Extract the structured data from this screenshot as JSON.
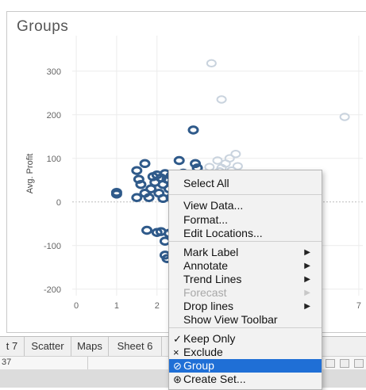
{
  "viz": {
    "title": "Groups"
  },
  "chart_data": {
    "type": "scatter",
    "ylabel": "Avg. Profit",
    "xlabel": "",
    "ylim": [
      -215,
      345
    ],
    "xlim": [
      -0.1,
      7.1
    ],
    "y_ticks": [
      "300",
      "200",
      "100",
      "0",
      "-100",
      "-200"
    ],
    "x_ticks": [
      "0",
      "1",
      "2",
      "7"
    ],
    "grid": true,
    "colors": {
      "selected": "#2f5a8a",
      "selected_fill": "#4f7fb4",
      "unselected": "#c9d3de"
    },
    "series": [
      {
        "name": "",
        "values": [
          [
            1.0,
            22
          ],
          [
            1.0,
            18
          ],
          [
            1.5,
            72
          ],
          [
            1.55,
            52
          ],
          [
            1.5,
            10
          ],
          [
            1.7,
            88
          ],
          [
            1.6,
            40
          ],
          [
            1.85,
            30
          ],
          [
            1.9,
            58
          ],
          [
            1.95,
            45
          ],
          [
            2.0,
            62
          ],
          [
            2.05,
            20
          ],
          [
            2.1,
            55
          ],
          [
            2.15,
            40
          ],
          [
            2.2,
            65
          ],
          [
            2.25,
            52
          ],
          [
            2.3,
            30
          ],
          [
            2.35,
            60
          ],
          [
            2.4,
            48
          ],
          [
            2.45,
            18
          ],
          [
            2.5,
            58
          ],
          [
            2.55,
            95
          ],
          [
            2.6,
            42
          ],
          [
            2.65,
            66
          ],
          [
            2.7,
            25
          ],
          [
            2.75,
            55
          ],
          [
            2.8,
            35
          ],
          [
            2.85,
            62
          ],
          [
            2.9,
            165
          ],
          [
            2.95,
            88
          ],
          [
            3.0,
            78
          ],
          [
            3.0,
            58
          ],
          [
            1.7,
            20
          ],
          [
            1.8,
            10
          ],
          [
            2.15,
            8
          ],
          [
            2.35,
            10
          ],
          [
            2.45,
            22
          ],
          [
            2.6,
            12
          ],
          [
            1.75,
            -65
          ],
          [
            2.0,
            -70
          ],
          [
            2.1,
            -68
          ],
          [
            2.2,
            -90
          ],
          [
            2.3,
            -72
          ],
          [
            2.4,
            -66
          ],
          [
            2.2,
            -122
          ],
          [
            2.25,
            -130
          ],
          [
            2.5,
            -125
          ]
        ]
      },
      {
        "name": "",
        "values": [
          [
            3.35,
            318
          ],
          [
            3.6,
            235
          ],
          [
            6.65,
            195
          ],
          [
            3.2,
            65
          ],
          [
            3.3,
            80
          ],
          [
            3.4,
            50
          ],
          [
            3.5,
            95
          ],
          [
            3.55,
            70
          ],
          [
            3.6,
            78
          ],
          [
            3.65,
            60
          ],
          [
            3.7,
            88
          ],
          [
            3.75,
            55
          ],
          [
            3.8,
            100
          ],
          [
            3.85,
            72
          ],
          [
            3.9,
            45
          ],
          [
            3.95,
            110
          ],
          [
            4.0,
            82
          ],
          [
            4.05,
            65
          ],
          [
            4.1,
            48
          ],
          [
            3.45,
            35
          ],
          [
            3.7,
            40
          ],
          [
            3.9,
            30
          ],
          [
            4.35,
            48
          ],
          [
            4.5,
            46
          ],
          [
            4.9,
            44
          ],
          [
            5.0,
            42
          ],
          [
            4.2,
            40
          ]
        ]
      }
    ]
  },
  "tabs": [
    "t 7",
    "Scatter",
    "Maps",
    "Sheet 6"
  ],
  "status": {
    "left_text": "37"
  },
  "context_menu": {
    "items": [
      {
        "label": "Select All",
        "arrow": false,
        "disabled": false,
        "check": "",
        "selected": false
      },
      {
        "label": "View Data...",
        "arrow": false,
        "disabled": false,
        "check": "",
        "selected": false
      },
      {
        "label": "Format...",
        "arrow": false,
        "disabled": false,
        "check": "",
        "selected": false
      },
      {
        "label": "Edit Locations...",
        "arrow": false,
        "disabled": false,
        "check": "",
        "selected": false
      },
      {
        "label": "Mark Label",
        "arrow": true,
        "disabled": false,
        "check": "",
        "selected": false
      },
      {
        "label": "Annotate",
        "arrow": true,
        "disabled": false,
        "check": "",
        "selected": false
      },
      {
        "label": "Trend Lines",
        "arrow": true,
        "disabled": false,
        "check": "",
        "selected": false
      },
      {
        "label": "Forecast",
        "arrow": true,
        "disabled": true,
        "check": "",
        "selected": false
      },
      {
        "label": "Drop lines",
        "arrow": true,
        "disabled": false,
        "check": "",
        "selected": false
      },
      {
        "label": "Show View Toolbar",
        "arrow": false,
        "disabled": false,
        "check": "",
        "selected": false
      },
      {
        "label": "Keep Only",
        "arrow": false,
        "disabled": false,
        "check": "✓",
        "selected": false
      },
      {
        "label": "Exclude",
        "arrow": false,
        "disabled": false,
        "check": "×",
        "selected": false
      },
      {
        "label": "Group",
        "arrow": false,
        "disabled": false,
        "check": "⊘",
        "selected": true
      },
      {
        "label": "Create Set...",
        "arrow": false,
        "disabled": false,
        "check": "⊛",
        "selected": false
      }
    ]
  }
}
